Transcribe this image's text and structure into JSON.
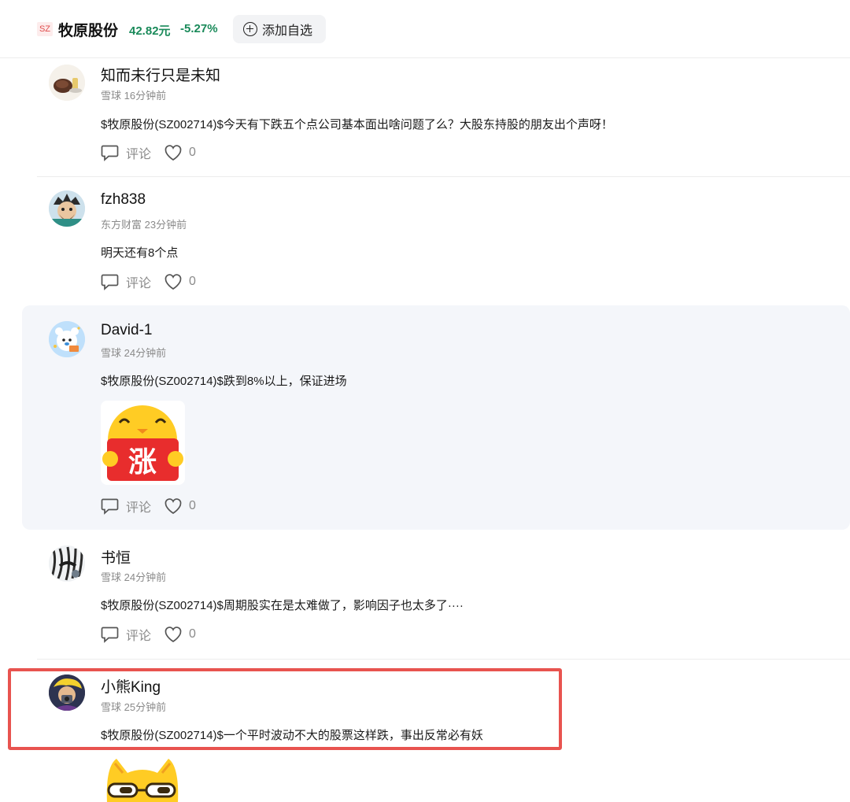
{
  "header": {
    "exchange": "SZ",
    "stock_name": "牧原股份",
    "price": "42.82元",
    "change": "-5.27%",
    "add_label": "添加自选"
  },
  "actions": {
    "comment_label": "评论"
  },
  "posts": [
    {
      "username": "知而未行只是未知",
      "source": "雪球",
      "time": "16分钟前",
      "content": "$牧原股份(SZ002714)$今天有下跌五个点公司基本面出啥问题了么？大股东持股的朋友出个声呀！",
      "likes": "0"
    },
    {
      "username": "fzh838",
      "source": "东方财富",
      "time": "23分钟前",
      "content": "明天还有8个点",
      "likes": "0"
    },
    {
      "username": "David-1",
      "source": "雪球",
      "time": "24分钟前",
      "content": "$牧原股份(SZ002714)$跌到8%以上，保证进场",
      "sticker_text": "涨",
      "likes": "0"
    },
    {
      "username": "书恒",
      "source": "雪球",
      "time": "24分钟前",
      "content": "$牧原股份(SZ002714)$周期股实在是太难做了，影响因子也太多了····",
      "likes": "0"
    },
    {
      "username": "小熊King",
      "source": "雪球",
      "time": "25分钟前",
      "content": "$牧原股份(SZ002714)$一个平时波动不大的股票这样跌，事出反常必有妖"
    }
  ]
}
